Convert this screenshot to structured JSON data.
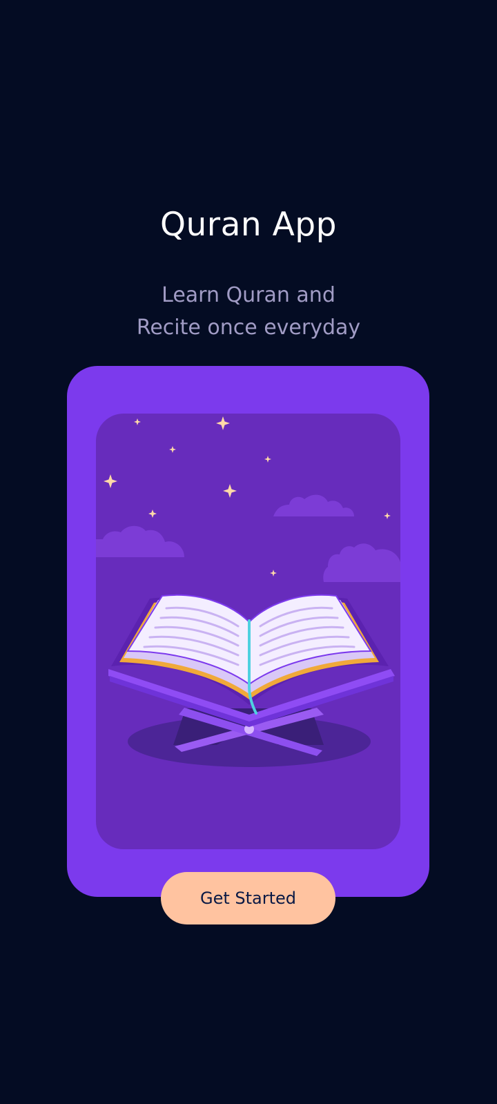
{
  "app": {
    "title": "Quran App",
    "subtitle_line1": "Learn Quran and",
    "subtitle_line2": "Recite once everyday"
  },
  "illustration": {
    "icon": "open-quran-book-on-rehal-icon",
    "decorations": [
      "sparkle-star-icon",
      "cloud-icon"
    ]
  },
  "cta": {
    "label": "Get Started"
  },
  "colors": {
    "background": "#040C23",
    "title": "#FFFFFF",
    "subtitle": "#A19CC5",
    "card": "#7C3AED",
    "panel": "#672CBC",
    "button": "#FFC3A0",
    "button_text": "#091945"
  }
}
